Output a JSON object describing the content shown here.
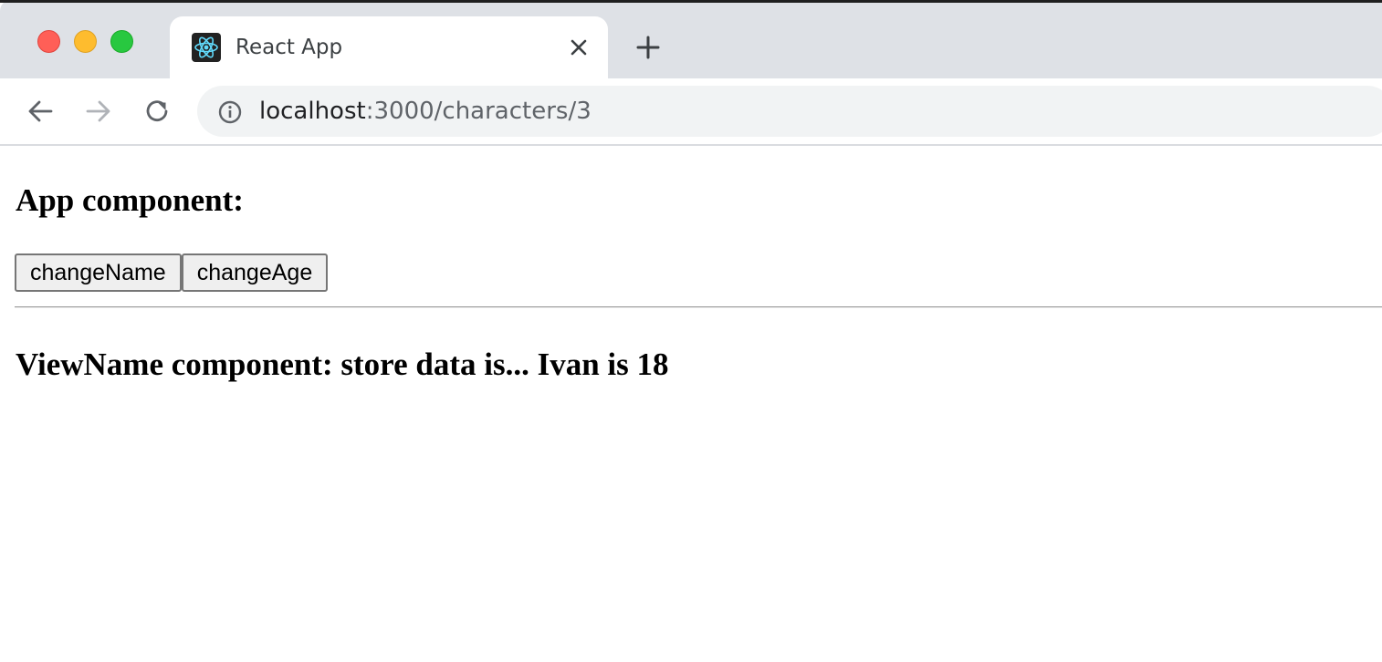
{
  "browser": {
    "tab": {
      "title": "React App",
      "favicon": "react-logo-icon"
    },
    "toolbar": {
      "back_icon": "arrow-left-icon",
      "forward_icon": "arrow-right-icon",
      "reload_icon": "reload-icon"
    },
    "address_bar": {
      "host": "localhost",
      "path": ":3000/characters/3",
      "info_icon": "info-icon"
    },
    "colors": {
      "close": "#ff5f57",
      "minimize": "#febc2e",
      "maximize": "#28c840",
      "react_accent": "#61dafb"
    }
  },
  "page": {
    "app_heading": "App component:",
    "buttons": {
      "change_name": "changeName",
      "change_age": "changeAge"
    },
    "view_heading": "ViewName component: store data is... Ivan is 18"
  }
}
